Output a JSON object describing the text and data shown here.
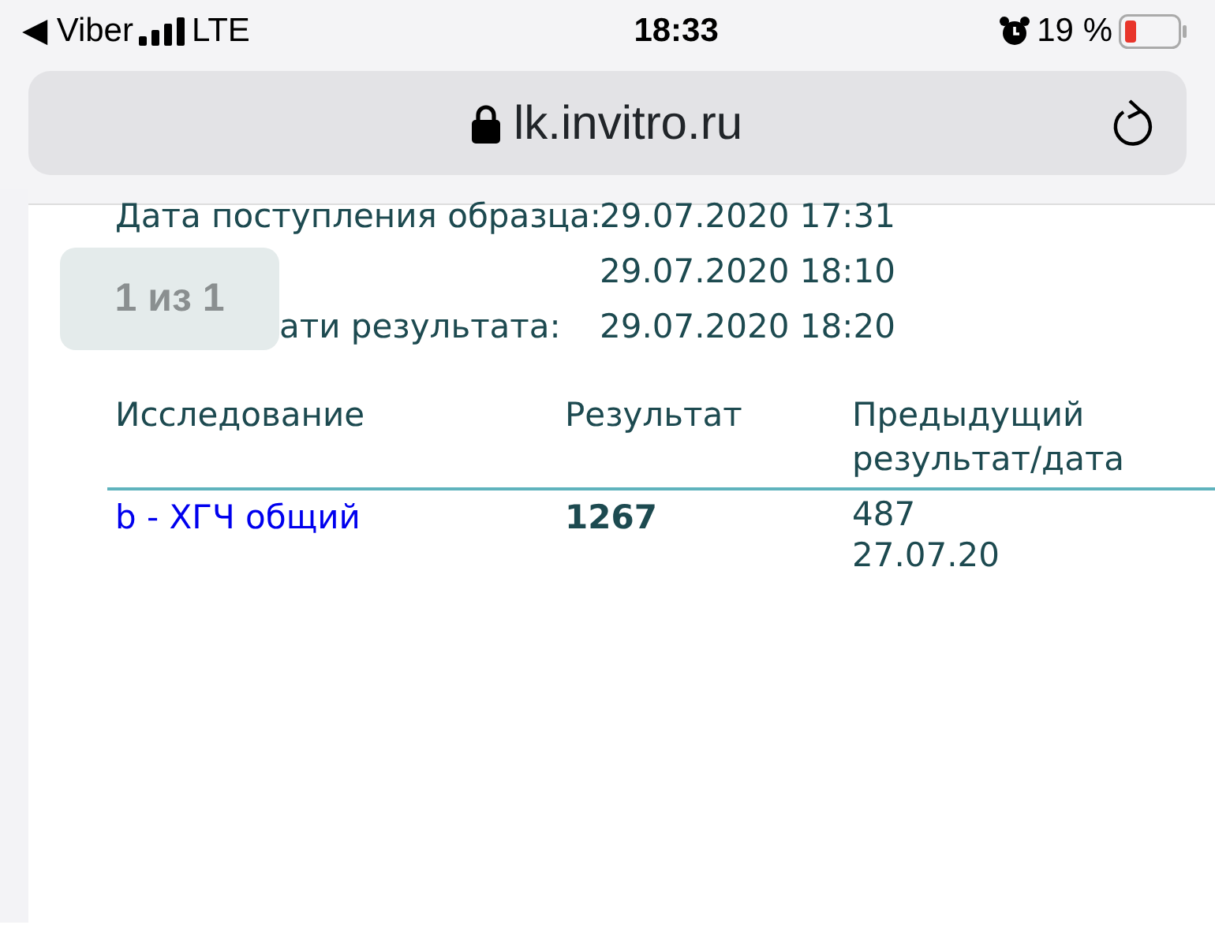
{
  "status_bar": {
    "back_app": "◀ Viber",
    "network": "LTE",
    "time": "18:33",
    "battery": "19 %"
  },
  "address_bar": {
    "url": "lk.invitro.ru"
  },
  "sample_info": [
    {
      "label": "Дата поступления образца:",
      "value": "29.07.2020 17:31"
    },
    {
      "value": "29.07.2020 18:10"
    },
    {
      "label": "ати результата:",
      "value": "29.07.2020 18:20"
    }
  ],
  "results_table": {
    "columns": [
      "Исследование",
      "Результат",
      "Предыдущий результат/дата"
    ],
    "rows": [
      {
        "test": "b - ХГЧ общий",
        "result": "1267",
        "previous": [
          "487",
          "27.07.20"
        ]
      }
    ]
  },
  "find_counter": {
    "text": "1 из 1"
  }
}
